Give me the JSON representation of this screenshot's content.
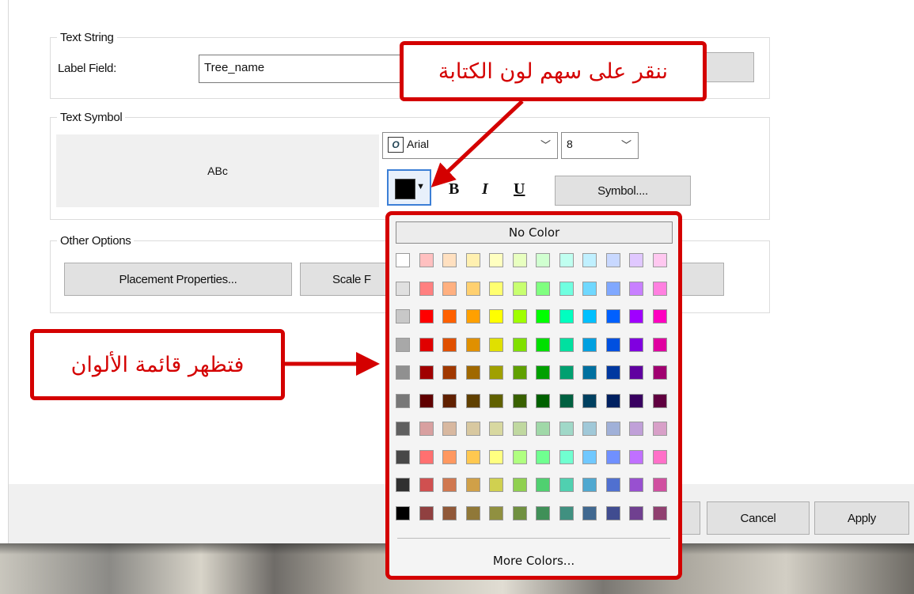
{
  "text_string": {
    "group_title": "Text String",
    "label_field_label": "Label Field:",
    "label_field_value": "Tree_name"
  },
  "text_symbol": {
    "group_title": "Text Symbol",
    "preview_text": "ABc",
    "font_name": "Arial",
    "font_size": "8",
    "symbol_button": "Symbol....",
    "bold": "B",
    "italic": "I",
    "underline": "U",
    "current_color": "#000000"
  },
  "other_options": {
    "group_title": "Other Options",
    "placement_button": "Placement Properties...",
    "scale_button": "Scale F"
  },
  "footer": {
    "cancel": "Cancel",
    "apply": "Apply"
  },
  "color_menu": {
    "no_color": "No Color",
    "more_colors": "More Colors...",
    "rows": [
      [
        "#ffffff",
        "#ffc0c0",
        "#ffe0c0",
        "#fff0b0",
        "#ffffc0",
        "#e8ffc0",
        "#d0ffd0",
        "#c0fff0",
        "#c0f0ff",
        "#c8d8ff",
        "#e0c8ff",
        "#ffc8f0"
      ],
      [
        "#e0e0e0",
        "#ff8080",
        "#ffb080",
        "#ffd070",
        "#ffff70",
        "#c8ff70",
        "#80ff80",
        "#70ffe0",
        "#70d8ff",
        "#80a8ff",
        "#c880ff",
        "#ff80e0"
      ],
      [
        "#c8c8c8",
        "#ff0000",
        "#ff6000",
        "#ffa000",
        "#ffff00",
        "#a0ff00",
        "#00ff00",
        "#00ffc0",
        "#00c0ff",
        "#0060ff",
        "#a000ff",
        "#ff00c0"
      ],
      [
        "#a8a8a8",
        "#e00000",
        "#e05000",
        "#e09000",
        "#e0e000",
        "#80e000",
        "#00e000",
        "#00e0a0",
        "#00a0e0",
        "#0050e0",
        "#8000e0",
        "#e000a0"
      ],
      [
        "#909090",
        "#a00000",
        "#a03800",
        "#a06800",
        "#a0a000",
        "#60a000",
        "#00a000",
        "#00a070",
        "#0070a0",
        "#0038a0",
        "#6000a0",
        "#a00070"
      ],
      [
        "#787878",
        "#600000",
        "#602000",
        "#604000",
        "#606000",
        "#386000",
        "#006000",
        "#006040",
        "#004060",
        "#002060",
        "#380060",
        "#600040"
      ],
      [
        "#606060",
        "#d8a0a0",
        "#d8b8a0",
        "#d8c8a0",
        "#d8d8a0",
        "#c0d8a0",
        "#a0d8a8",
        "#a0d8c8",
        "#a0c8d8",
        "#a0b0d8",
        "#c0a0d8",
        "#d8a0c8"
      ],
      [
        "#484848",
        "#ff7070",
        "#ff9860",
        "#ffc850",
        "#ffff80",
        "#b0ff80",
        "#70ff90",
        "#70ffd0",
        "#70c8ff",
        "#7090ff",
        "#c070ff",
        "#ff70c8"
      ],
      [
        "#303030",
        "#d05050",
        "#d07850",
        "#d0a048",
        "#d0d050",
        "#90d050",
        "#50d070",
        "#50d0b0",
        "#50a8d0",
        "#5070d0",
        "#9850d0",
        "#d050a0"
      ],
      [
        "#000000",
        "#904040",
        "#905838",
        "#907838",
        "#909040",
        "#709040",
        "#409058",
        "#409080",
        "#406890",
        "#404c90",
        "#704090",
        "#904070"
      ]
    ]
  },
  "annotations": {
    "top_callout": "ننقر على سهم لون الكتابة",
    "left_callout": "فتظهر  قائمة الألوان"
  }
}
